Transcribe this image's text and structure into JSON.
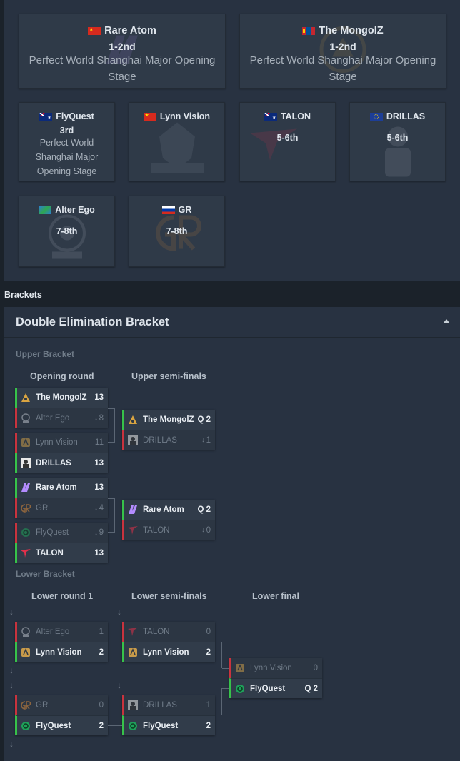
{
  "placements": {
    "rare_atom": {
      "team": "Rare Atom",
      "place": "1-2nd",
      "event": "Perfect World Shanghai Major Opening Stage",
      "flag": "cn"
    },
    "the_mongolz": {
      "team": "The MongolZ",
      "place": "1-2nd",
      "event": "Perfect World Shanghai Major Opening Stage",
      "flag": "mn"
    },
    "flyquest": {
      "team": "FlyQuest",
      "place": "3rd",
      "event": "Perfect World Shanghai Major Opening Stage",
      "flag": "au"
    },
    "lynn_vision": {
      "team": "Lynn Vision",
      "flag": "cn"
    },
    "talon": {
      "team": "TALON",
      "place": "5-6th",
      "flag": "au"
    },
    "drillas": {
      "team": "DRILLAS",
      "place": "5-6th",
      "flag": "eu"
    },
    "alter_ego": {
      "team": "Alter Ego",
      "place": "7-8th",
      "flag": "world"
    },
    "gr": {
      "team": "GR",
      "place": "7-8th",
      "flag": "ru"
    }
  },
  "brackets_label": "Brackets",
  "bracket": {
    "title": "Double Elimination Bracket",
    "upper_label": "Upper Bracket",
    "lower_label": "Lower Bracket",
    "rounds": {
      "opening": "Opening round",
      "upper_semis": "Upper semi-finals",
      "lower_r1": "Lower round 1",
      "lower_semis": "Lower semi-finals",
      "lower_final": "Lower final"
    }
  },
  "matches": {
    "ub1": [
      {
        "team": "The MongolZ",
        "score": "13",
        "winner": true,
        "logo": "mongolz"
      },
      {
        "team": "Alter Ego",
        "score": "8",
        "winner": false,
        "logo": "alterego"
      }
    ],
    "ub2": [
      {
        "team": "Lynn Vision",
        "score": "11",
        "winner": false,
        "logo": "lynn"
      },
      {
        "team": "DRILLAS",
        "score": "13",
        "winner": true,
        "logo": "drillas"
      }
    ],
    "ub3": [
      {
        "team": "Rare Atom",
        "score": "13",
        "winner": true,
        "logo": "rareatom"
      },
      {
        "team": "GR",
        "score": "4",
        "winner": false,
        "logo": "gr"
      }
    ],
    "ub4": [
      {
        "team": "FlyQuest",
        "score": "9",
        "winner": false,
        "logo": "flyquest"
      },
      {
        "team": "TALON",
        "score": "13",
        "winner": true,
        "logo": "talon"
      }
    ],
    "us1": [
      {
        "team": "The MongolZ",
        "score": "Q 2",
        "winner": true,
        "logo": "mongolz"
      },
      {
        "team": "DRILLAS",
        "score": "1",
        "winner": false,
        "logo": "drillas"
      }
    ],
    "us2": [
      {
        "team": "Rare Atom",
        "score": "Q 2",
        "winner": true,
        "logo": "rareatom"
      },
      {
        "team": "TALON",
        "score": "0",
        "winner": false,
        "logo": "talon"
      }
    ],
    "lr1a": [
      {
        "team": "Alter Ego",
        "score": "1",
        "winner": false,
        "logo": "alterego"
      },
      {
        "team": "Lynn Vision",
        "score": "2",
        "winner": true,
        "logo": "lynn"
      }
    ],
    "lr1b": [
      {
        "team": "GR",
        "score": "0",
        "winner": false,
        "logo": "gr"
      },
      {
        "team": "FlyQuest",
        "score": "2",
        "winner": true,
        "logo": "flyquest"
      }
    ],
    "ls1": [
      {
        "team": "TALON",
        "score": "0",
        "winner": false,
        "logo": "talon"
      },
      {
        "team": "Lynn Vision",
        "score": "2",
        "winner": true,
        "logo": "lynn"
      }
    ],
    "ls2": [
      {
        "team": "DRILLAS",
        "score": "1",
        "winner": false,
        "logo": "drillas"
      },
      {
        "team": "FlyQuest",
        "score": "2",
        "winner": true,
        "logo": "flyquest"
      }
    ],
    "lf": [
      {
        "team": "Lynn Vision",
        "score": "0",
        "winner": false,
        "logo": "lynn"
      },
      {
        "team": "FlyQuest",
        "score": "Q 2",
        "winner": true,
        "logo": "flyquest"
      }
    ]
  }
}
